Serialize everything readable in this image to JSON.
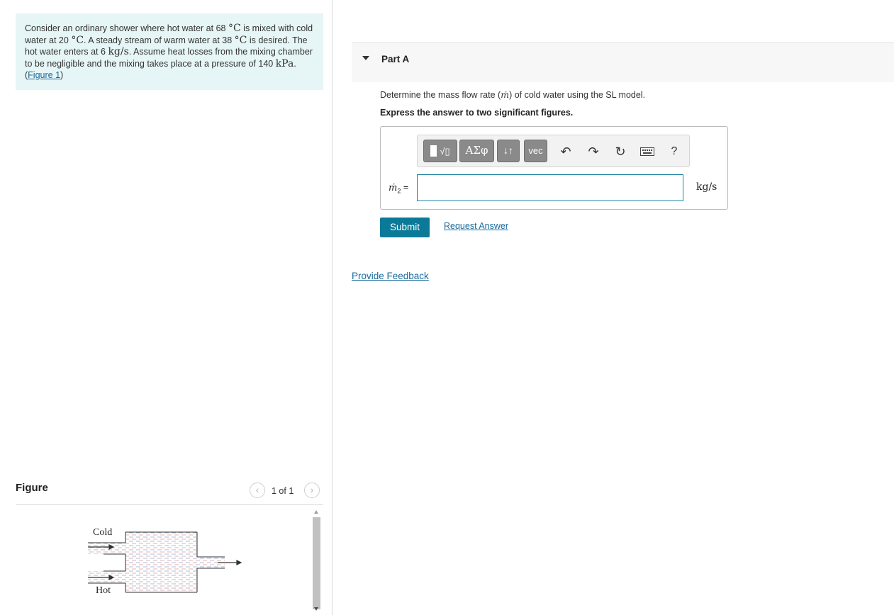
{
  "problem": {
    "text_1": "Consider an ordinary shower where hot water at 68",
    "unit_c": "°C",
    "text_2": " is mixed with cold water at 20",
    "text_3": ". A steady stream of warm water at 38",
    "text_4": " is desired. The hot water enters at 6 ",
    "unit_kgs": "kg/s",
    "text_5": ". Assume heat losses from the mixing chamber to be negligible and the mixing takes place at a pressure of 140 ",
    "unit_kpa": "kPa",
    "text_6": ". (",
    "figure_link": "Figure 1",
    "text_7": ")"
  },
  "figure": {
    "title": "Figure",
    "counter": "1 of 1",
    "prev_icon": "chevron-left-icon",
    "next_icon": "chevron-right-icon",
    "label_cold": "Cold",
    "label_hot": "Hot"
  },
  "part": {
    "title": "Part A",
    "question_pre": "Determine the mass flow rate (",
    "question_symbol": "ṁ",
    "question_post": ") of cold water using the SL model.",
    "instruction": "Express the answer to two significant figures."
  },
  "toolbar": {
    "greek_label": "ΑΣφ",
    "updown_label": "↓↑",
    "vec_label": "vec",
    "undo_icon": "↶",
    "redo_icon": "↷",
    "reset_icon": "↻",
    "help_label": "?"
  },
  "answer": {
    "variable": "ṁ",
    "subscript": "2",
    "equals": " =",
    "value": "",
    "units": "kg/s"
  },
  "actions": {
    "submit_label": "Submit",
    "request_label": "Request Answer",
    "feedback_label": "Provide Feedback"
  },
  "colors": {
    "problem_bg": "#e6f5f5",
    "accent": "#0b7a99",
    "link": "#1a6b9b"
  }
}
